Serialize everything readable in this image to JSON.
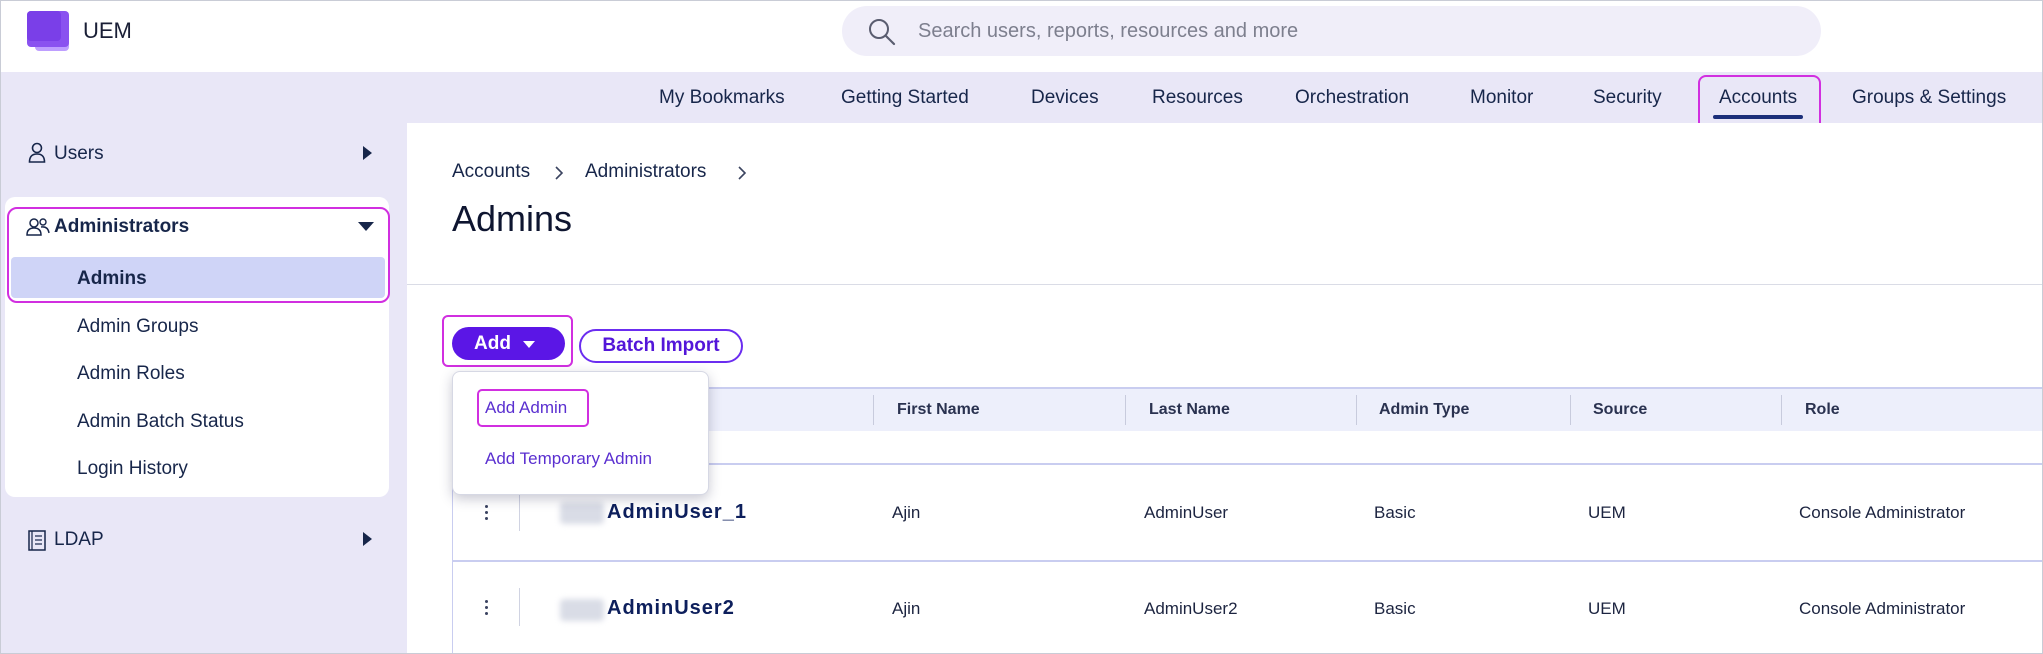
{
  "app": {
    "name": "UEM"
  },
  "search": {
    "placeholder": "Search users, reports, resources and more"
  },
  "nav": {
    "items": [
      {
        "label": "My Bookmarks"
      },
      {
        "label": "Getting Started"
      },
      {
        "label": "Devices"
      },
      {
        "label": "Resources"
      },
      {
        "label": "Orchestration"
      },
      {
        "label": "Monitor"
      },
      {
        "label": "Security"
      },
      {
        "label": "Accounts"
      },
      {
        "label": "Groups & Settings"
      }
    ],
    "active": "Accounts"
  },
  "sidebar": {
    "users": "Users",
    "administrators": "Administrators",
    "sub_items": [
      {
        "label": "Admins"
      },
      {
        "label": "Admin Groups"
      },
      {
        "label": "Admin Roles"
      },
      {
        "label": "Admin Batch Status"
      },
      {
        "label": "Login History"
      }
    ],
    "ldap": "LDAP"
  },
  "breadcrumb": {
    "items": [
      "Accounts",
      "Administrators"
    ]
  },
  "page": {
    "title": "Admins"
  },
  "toolbar": {
    "add_label": "Add",
    "batch_import_label": "Batch Import"
  },
  "dropdown": {
    "items": [
      "Add Admin",
      "Add Temporary Admin"
    ]
  },
  "table": {
    "columns": [
      "First Name",
      "Last Name",
      "Admin Type",
      "Source",
      "Role"
    ],
    "rows": [
      {
        "username": "AdminUser_1",
        "first": "Ajin",
        "last": "AdminUser",
        "type": "Basic",
        "source": "UEM",
        "role": "Console Administrator"
      },
      {
        "username": "AdminUser2",
        "first": "Ajin",
        "last": "AdminUser2",
        "type": "Basic",
        "source": "UEM",
        "role": "Console Administrator"
      }
    ]
  },
  "colors": {
    "accent": "#5b16e6",
    "highlight": "#d12fe0",
    "nav_bg": "#e9e7f7"
  }
}
